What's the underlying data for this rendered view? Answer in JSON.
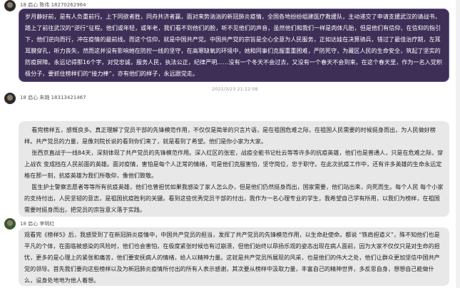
{
  "messages": [
    {
      "sender": "18 启心 陈伟 18270262964",
      "paragraphs": [
        "岁月静好前，是有人负重前行。上下同欲者胜，同舟共济者赢，面对来势汹汹的新冠肺炎疫情，全国各地纷纷组建医疗救援队，主动递交了申请支援武汉的请战书，踏上了前往武汉的“逆行”征程。他们或年轻，或年老，我们看不到他们的脸，听不见他们的声音，虽然他们和我们一样是肉体凡胎，但是他们有信仰，在信仰的指引下，他们逆向而行，冲在疫情的最前线。而这个信仰，就是中国共产党。中国共产党的宗旨是全心全意为人民服务，正如达娃在决算骑兵，错过了最佳治疗期，左耳耳膜穿孔，听力丧失，然而这并没有影响她在防控一线的坚守，在高寒缺氧的环境中，她和同事们克服重重困难，严防死守，为藏区人民的生命安全，筑起了坚实的防疫屏障。永远记得那16个字，对党忠诚，服务人民，执法公正，纪律严明……没有一个冬天不会过去，又没有一个春天不会到来，在这个春天里，作为一名入党积极分子，要抓住榜样们的“接力棒”，亦有他们的样子，永远跟党走。"
      ]
    },
    {
      "sender": "18 启心 朱璐 18313421467",
      "timestamp": "2021/3/23 21:12:08",
      "paragraphs": [
        "    看完榜样五，感慨良多。真正理解了党员干部的先锋模范作用，不仅仅是简单的只言片语，是在祖国危难之际，在祖国人民需要的时候挺身而出，为人民做好榜样。共产党员的力量，是像刘院长说的看到你们来了，就是看到了希望。他们是你小家为大家。",
        "    张西京直战于一线84天，深刻体现了共产党员的先锋模范作用。深入红区的张宏，战疫全能书记杜云等等许多的抗疫英雄，他们也是普通人，只是在危难之际，穿上战衣 变成挡在人民前面的英雄。面对疫情，害怕是每个人正常的情绪，可是他们克服害怕，坚守岗位，忠于职守。在此次抗疫工作中，还有许多英雄的生命永远定格在那一刻，抗疫英雄为我们所敬仰，像他们致敬。",
        "    医生护士警察志愿者等等所有抗疫英雄，他们也曾担忧如果我感染了家人怎么办，但是他们仍然挺身而出，国家需要，他们站出来，向死而生。每个人民 每个小家的支持付出，人民坚韧的意志，是祖国抗疫胜利的关键。看到这些优秀党员干部的付出，我作为一名心理专业的学生，我希望自己学有所用，以我们为榜样，在祖国需要时挺身而出，把党员的宗旨意义落于实践。"
      ]
    },
    {
      "sender": "18 启心 李明红",
      "paragraphs": [
        "观看完《榜样5》后，我感受到了在新冠肺炎疫情中，中国共产党员的担当，发挥了共产党员的先锋模范作用，以生命赴使命。都说 “铁肩担道义”，殊不知他们也是平凡的个体，在面临被感染的风险时，他们也会害怕，在极度紧张时候也有过崩溃，但他们始终以昂扬乐观的姿态出现在病人面前，因为大家不仅仅只是对生命的担忧，更多的是心理上的紧张和痛苦，他们要安抚病人的情绪，给人以精神力量。这就是共产党员所展现的风采，也是他们的伟大之处，他们让群众更加坚信中国共产党的领导。首先我们要向这些榜样以及为新冠肺炎疫情所付出的所有人表示感谢，其次要从榜样中汲取力量，丰富自己的精神世界，多反思自身，想想自己能做什么，设身处地地为他人着想。"
      ]
    }
  ],
  "colors": {
    "highlight_bubble": "#3e2f57",
    "normal_bubble": "#e8e8e8"
  }
}
